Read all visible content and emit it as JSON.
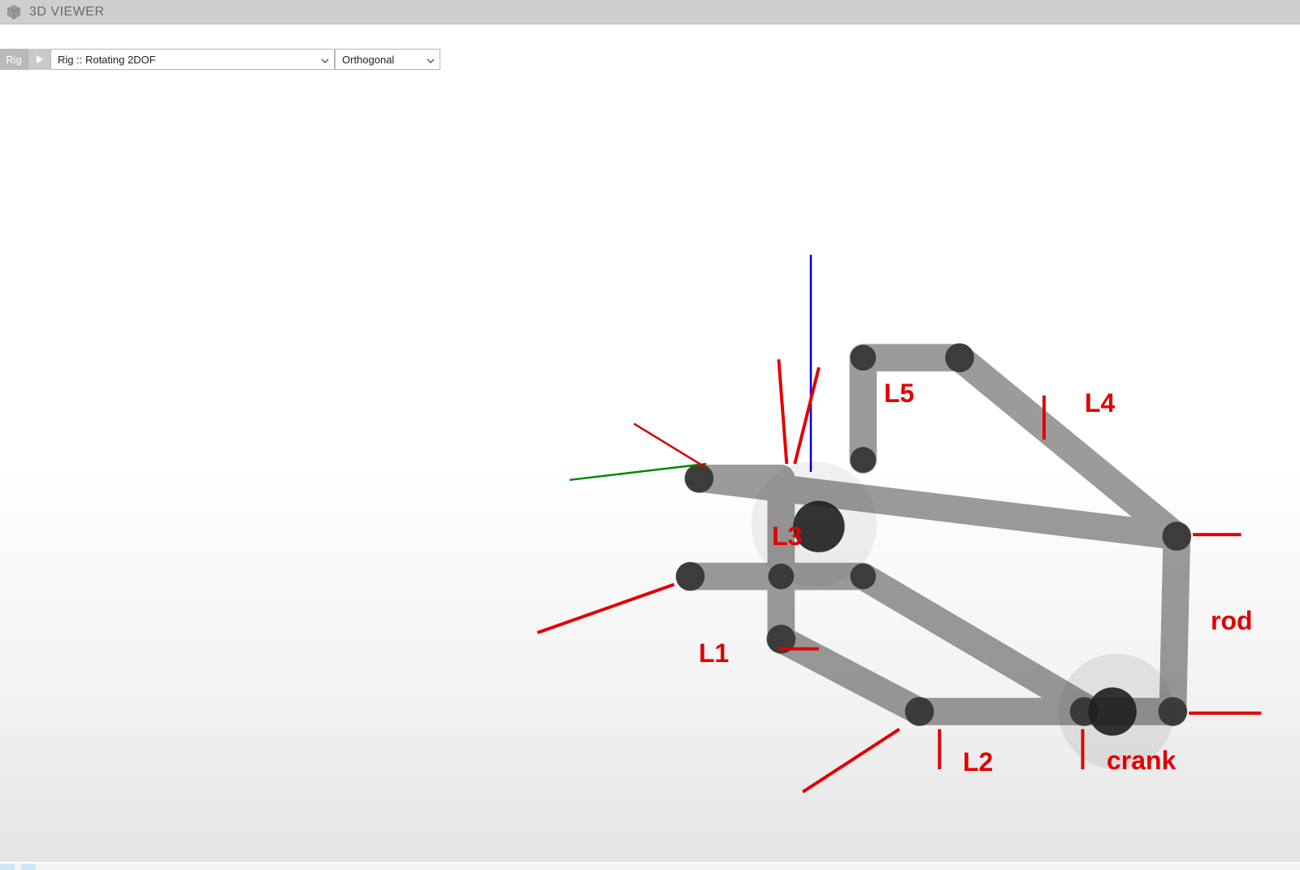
{
  "window": {
    "title": "3D VIEWER"
  },
  "toolbar": {
    "rig_label": "Rig",
    "rig_select": {
      "value": "Rig :: Rotating 2DOF"
    },
    "projection_select": {
      "value": "Orthogonal"
    }
  },
  "annotations": {
    "L1": "L1",
    "L2": "L2",
    "L3": "L3",
    "L4": "L4",
    "L5": "L5",
    "rod": "rod",
    "crank": "crank"
  },
  "colors": {
    "annotation": "#e10000",
    "axis_x": "#d00000",
    "axis_y": "#008800",
    "axis_z": "#0000d8",
    "link": "#555555"
  }
}
